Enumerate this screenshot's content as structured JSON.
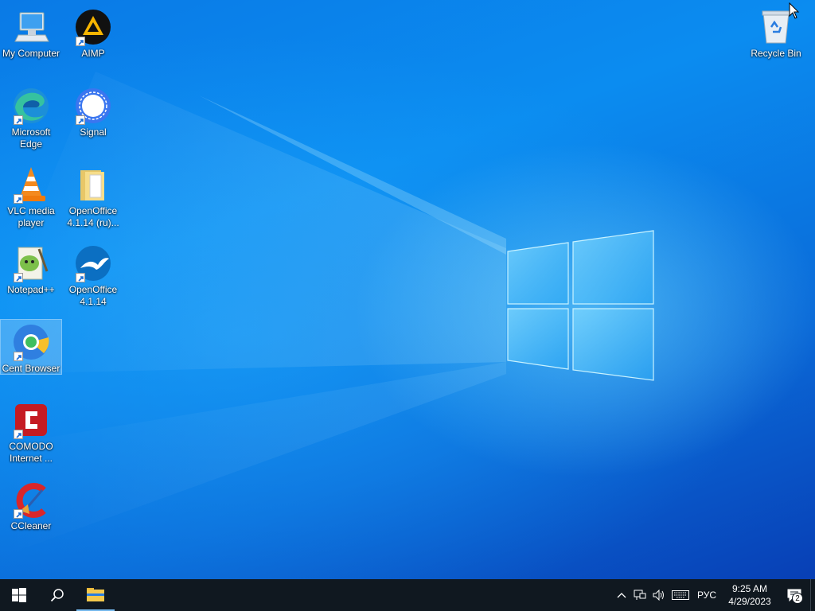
{
  "desktop": {
    "icons": [
      {
        "label": "My Computer",
        "icon": "computer-icon"
      },
      {
        "label": "AIMP",
        "icon": "aimp-icon"
      },
      {
        "label": "Recycle Bin",
        "icon": "recycle-bin-icon"
      },
      {
        "label": "Microsoft Edge",
        "icon": "edge-icon"
      },
      {
        "label": "Signal",
        "icon": "signal-icon"
      },
      {
        "label": "VLC media player",
        "icon": "vlc-icon"
      },
      {
        "label": "OpenOffice 4.1.14 (ru)...",
        "icon": "folder-icon"
      },
      {
        "label": "Notepad++",
        "icon": "notepadpp-icon"
      },
      {
        "label": "OpenOffice 4.1.14",
        "icon": "openoffice-icon"
      },
      {
        "label": "Cent Browser",
        "icon": "cent-browser-icon"
      },
      {
        "label": "COMODO Internet ...",
        "icon": "comodo-icon"
      },
      {
        "label": "CCleaner",
        "icon": "ccleaner-icon"
      }
    ],
    "selected": "Cent Browser"
  },
  "taskbar": {
    "start_icon": "windows-logo-icon",
    "search_icon": "search-icon",
    "pinned": [
      {
        "name": "File Explorer",
        "icon": "file-explorer-icon"
      }
    ],
    "tray": {
      "language": "РУС",
      "time": "9:25 AM",
      "date": "4/29/2023",
      "notifications": "2"
    }
  },
  "colors": {
    "taskbar": "#101820",
    "wallpaper_accent": "#0a7ae6"
  }
}
